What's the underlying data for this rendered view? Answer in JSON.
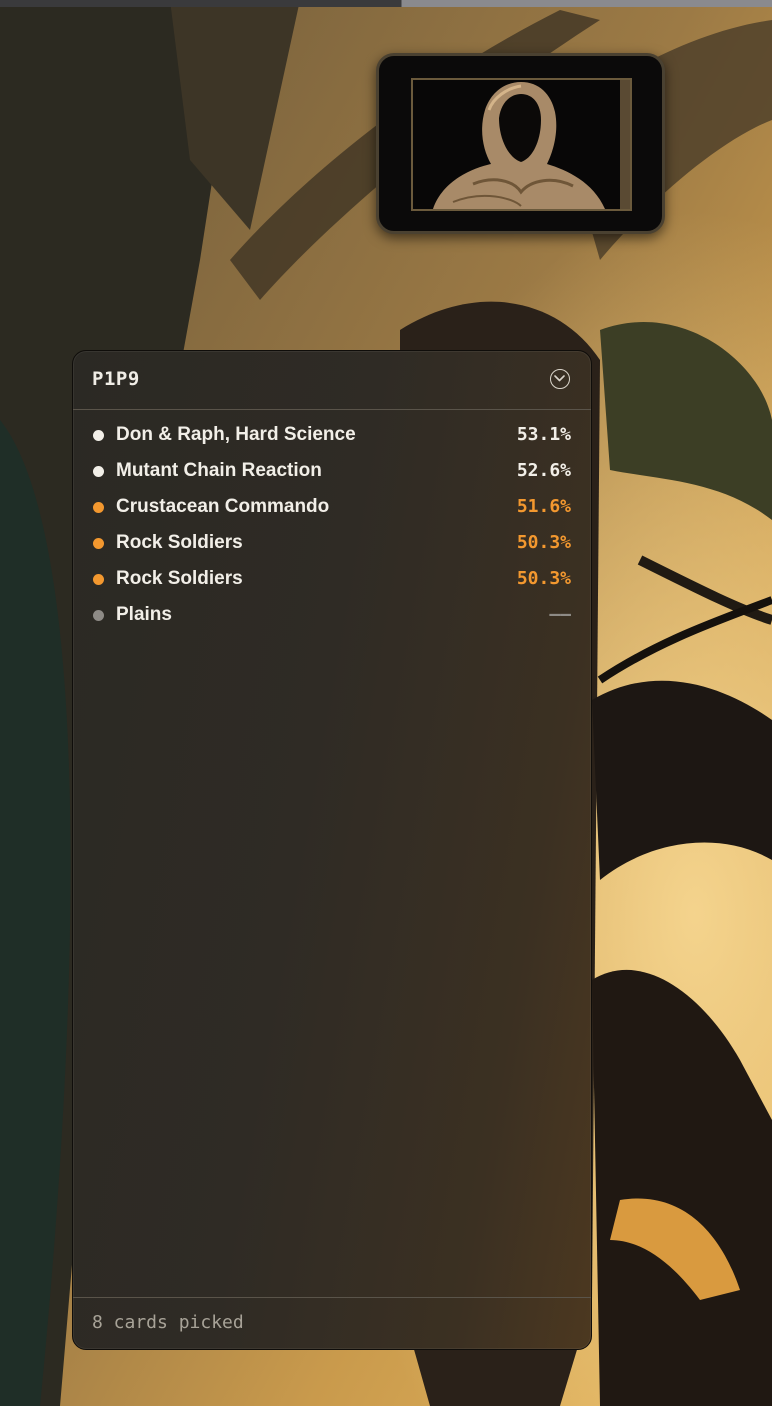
{
  "panel": {
    "title": "P1P9",
    "collapse_icon": "chevron-down-circle-icon",
    "footer": "8 cards picked"
  },
  "picks": [
    {
      "name": "Don & Raph, Hard Science",
      "rate": "53.1%",
      "color": "#f2efe8"
    },
    {
      "name": "Mutant Chain Reaction",
      "rate": "52.6%",
      "color": "#f2efe8"
    },
    {
      "name": "Crustacean Commando",
      "rate": "51.6%",
      "color": "#f3982f"
    },
    {
      "name": "Rock Soldiers",
      "rate": "50.3%",
      "color": "#f3982f"
    },
    {
      "name": "Rock Soldiers",
      "rate": "50.3%",
      "color": "#f3982f"
    },
    {
      "name": "Plains",
      "rate": "——",
      "color": "#8e8b86"
    }
  ],
  "colors": {
    "accent_orange": "#f3982f",
    "text_primary": "#f2efe8",
    "text_muted": "#a8a398"
  }
}
